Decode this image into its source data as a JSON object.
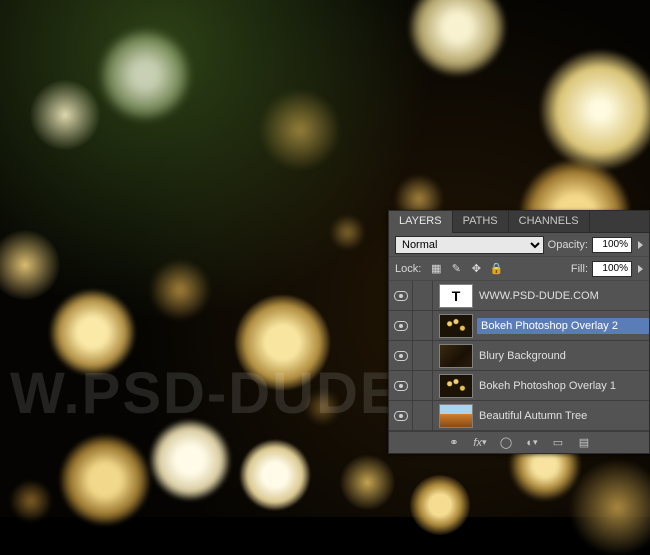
{
  "watermark_text": "W.PSD-DUDE.CO",
  "panel": {
    "tabs": {
      "layers": "LAYERS",
      "paths": "PATHS",
      "channels": "CHANNELS"
    },
    "blend_mode": "Normal",
    "opacity_label": "Opacity:",
    "opacity_value": "100%",
    "lock_label": "Lock:",
    "fill_label": "Fill:",
    "fill_value": "100%",
    "layers": [
      {
        "name": "WWW.PSD-DUDE.COM",
        "thumb_letter": "T"
      },
      {
        "name": "Bokeh Photoshop Overlay 2"
      },
      {
        "name": "Blury Background"
      },
      {
        "name": "Bokeh Photoshop Overlay 1"
      },
      {
        "name": "Beautiful Autumn Tree"
      }
    ]
  }
}
